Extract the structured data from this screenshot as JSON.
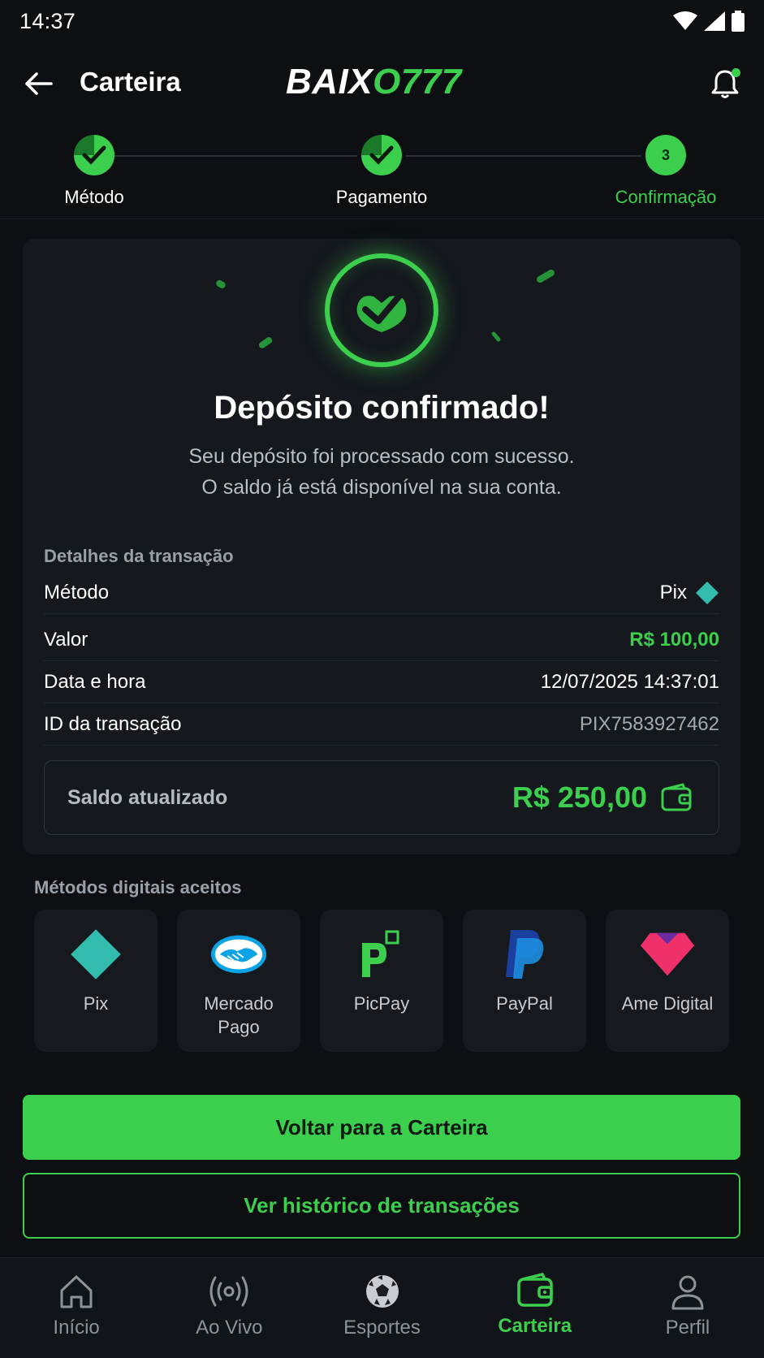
{
  "status_bar": {
    "time": "14:37"
  },
  "header": {
    "title": "Carteira",
    "logo_white": "BAIX",
    "logo_green": "O777"
  },
  "stepper": {
    "steps": [
      {
        "label": "Método",
        "state": "done"
      },
      {
        "label": "Pagamento",
        "state": "done"
      },
      {
        "label": "Confirmação",
        "number": "3",
        "state": "active"
      }
    ]
  },
  "confirmation": {
    "title": "Depósito confirmado!",
    "subtitle_line1": "Seu depósito foi processado com sucesso.",
    "subtitle_line2": "O saldo já está disponível na sua conta."
  },
  "details": {
    "heading": "Detalhes da transação",
    "rows": [
      {
        "label": "Método",
        "value": "Pix"
      },
      {
        "label": "Valor",
        "value": "R$ 100,00"
      },
      {
        "label": "Data e hora",
        "value": "12/07/2025 14:37:01"
      },
      {
        "label": "ID da transação",
        "value": "PIX7583927462"
      }
    ],
    "balance_label": "Saldo atualizado",
    "balance_value": "R$ 250,00"
  },
  "methods": {
    "heading": "Métodos digitais aceitos",
    "items": [
      {
        "name": "Pix",
        "icon": "pix-icon"
      },
      {
        "name": "Mercado Pago",
        "icon": "mercado-pago-icon"
      },
      {
        "name": "PicPay",
        "icon": "picpay-icon"
      },
      {
        "name": "PayPal",
        "icon": "paypal-icon"
      },
      {
        "name": "Ame Digital",
        "icon": "ame-digital-icon"
      }
    ]
  },
  "actions": {
    "primary": "Voltar para a Carteira",
    "secondary": "Ver histórico de transações"
  },
  "bottom_nav": {
    "items": [
      {
        "label": "Início",
        "icon": "home-icon"
      },
      {
        "label": "Ao Vivo",
        "icon": "live-icon"
      },
      {
        "label": "Esportes",
        "icon": "soccer-ball-icon"
      },
      {
        "label": "Carteira",
        "icon": "wallet-icon",
        "active": true
      },
      {
        "label": "Perfil",
        "icon": "profile-icon"
      }
    ]
  },
  "colors": {
    "accent": "#3ccf4e",
    "background": "#0d0f12",
    "card": "#15181d"
  }
}
